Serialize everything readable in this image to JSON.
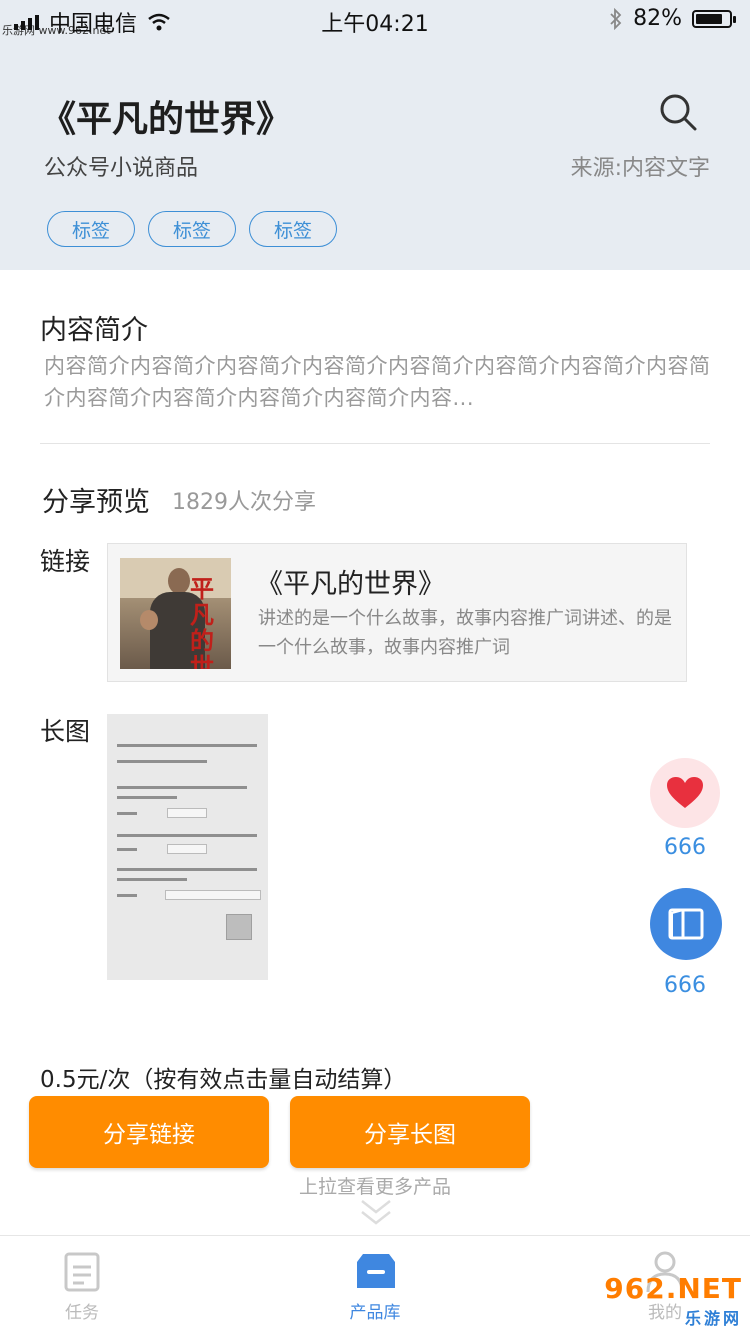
{
  "status_bar": {
    "carrier": "中国电信",
    "site_watermark": "乐游网 www.962.net",
    "time": "上午04:21",
    "battery_percent": "82%",
    "battery_level": 0.82
  },
  "header": {
    "title": "《平凡的世界》",
    "subtitle": "公众号小说商品",
    "source": "来源:内容文字",
    "tags": [
      "标签",
      "标签",
      "标签"
    ],
    "search_icon": "search-icon"
  },
  "intro": {
    "heading": "内容简介",
    "text": "内容简介内容简介内容简介内容简介内容简介内容简介内容简介内容简介内容简介内容简介内容简介内容简介内容..."
  },
  "share_preview": {
    "heading": "分享预览",
    "count": "1829人次分享",
    "link_label": "链接",
    "long_label": "长图",
    "link_card": {
      "title": "《平凡的世界》",
      "desc": "讲述的是一个什么故事，故事内容推广词讲述、的是一个什么故事，故事内容推广词",
      "poster_text": "平凡的世界"
    }
  },
  "floating": {
    "like_count": "666",
    "read_count": "666",
    "like_icon": "heart-icon",
    "read_icon": "book-icon"
  },
  "pricing": {
    "text": "0.5元/次（按有效点击量自动结算）",
    "share_link_btn": "分享链接",
    "share_long_btn": "分享长图",
    "pull_hint": "上拉查看更多产品"
  },
  "tabbar": {
    "items": [
      {
        "label": "任务",
        "icon": "task-icon",
        "active": false
      },
      {
        "label": "产品库",
        "icon": "box-icon",
        "active": true
      },
      {
        "label": "我的",
        "icon": "user-icon",
        "active": false
      }
    ],
    "watermark": "962.NET",
    "watermark_sub": "乐游网"
  },
  "colors": {
    "accent": "#3f87e0",
    "orange": "#ff8c00",
    "header_bg": "#e7ecf2"
  }
}
